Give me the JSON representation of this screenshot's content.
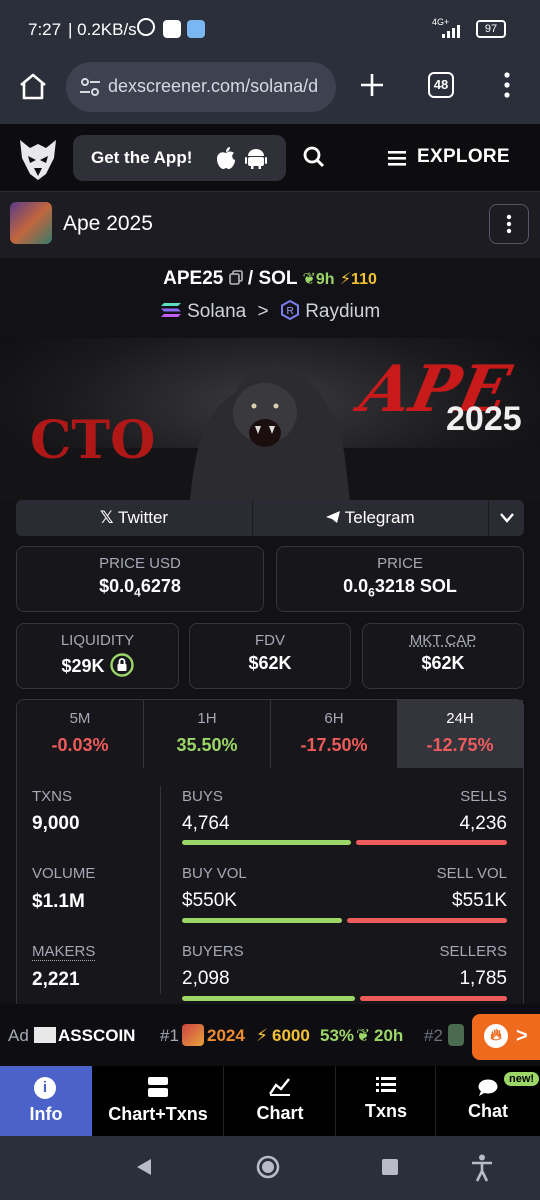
{
  "status_bar": {
    "time": "7:27",
    "speed": "| 0.2KB/s",
    "network": "4G+",
    "battery": "97"
  },
  "browser": {
    "url": "dexscreener.com/solana/d",
    "tab_count": "48"
  },
  "site_header": {
    "get_app_label": "Get the App!",
    "explore_label": "EXPLORE"
  },
  "token": {
    "name": "Ape 2025",
    "base_symbol": "APE25",
    "separator": "/",
    "quote_symbol": "SOL",
    "age": "9h",
    "boosts": "110",
    "chain": "Solana",
    "dex": "Raydium"
  },
  "banner": {
    "left_text": "CTO",
    "title_text": "APE",
    "year_text": "2025"
  },
  "social": {
    "twitter_label": "Twitter",
    "telegram_label": "Telegram"
  },
  "prices": {
    "price_usd_label": "PRICE USD",
    "price_usd_prefix": "$0.0",
    "price_usd_sub": "4",
    "price_usd_suffix": "6278",
    "price_label": "PRICE",
    "price_sol_prefix": "0.0",
    "price_sol_sub": "6",
    "price_sol_suffix": "3218 SOL"
  },
  "metrics": {
    "liquidity_label": "LIQUIDITY",
    "liquidity_value": "$29K",
    "fdv_label": "FDV",
    "fdv_value": "$62K",
    "mktcap_label": "MKT CAP",
    "mktcap_value": "$62K"
  },
  "timeframes": [
    {
      "label": "5M",
      "value": "-0.03%",
      "color": "#ee5b5b"
    },
    {
      "label": "1H",
      "value": "35.50%",
      "color": "#9cd667"
    },
    {
      "label": "6H",
      "value": "-17.50%",
      "color": "#ee5b5b"
    },
    {
      "label": "24H",
      "value": "-12.75%",
      "color": "#ee5b5b"
    }
  ],
  "stats": {
    "txns_label": "TXNS",
    "txns_value": "9,000",
    "volume_label": "VOLUME",
    "volume_value": "$1.1M",
    "makers_label": "MAKERS",
    "makers_value": "2,221",
    "buys_label": "BUYS",
    "buys_value": "4,764",
    "sells_label": "SELLS",
    "sells_value": "4,236",
    "buy_share": 0.529,
    "buyvol_label": "BUY VOL",
    "buyvol_value": "$550K",
    "sellvol_label": "SELL VOL",
    "sellvol_value": "$551K",
    "buyvol_share": 0.499,
    "buyers_label": "BUYERS",
    "buyers_value": "2,098",
    "sellers_label": "SELLERS",
    "sellers_value": "1,785",
    "buyers_share": 0.54
  },
  "ad_row": {
    "ad_label": "Ad",
    "ad_name": "ASSCOIN",
    "rank1": "#1",
    "trend_name": "2024",
    "trend_boost": "6000",
    "trend_change": "53%",
    "trend_age": "20h",
    "rank2": "#2"
  },
  "bottom_nav": {
    "info": "Info",
    "chart_txns": "Chart+Txns",
    "chart": "Chart",
    "txns": "Txns",
    "chat": "Chat",
    "new_badge": "new!"
  },
  "colors": {
    "green": "#9cd667",
    "red": "#ee5b5b",
    "active_tab": "#4a62c9",
    "boost": "#f2c233"
  }
}
